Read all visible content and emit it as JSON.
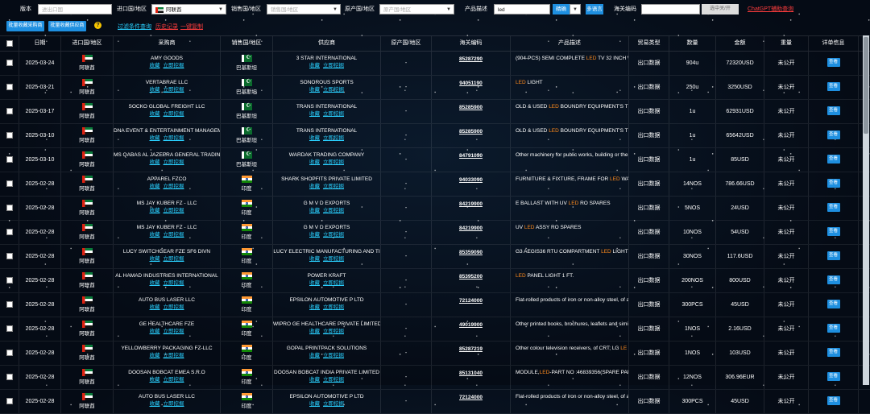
{
  "filters": {
    "version_label": "版本",
    "import_country_label": "进口国/地区",
    "import_country_value": "阿联酋",
    "import_country_box_placeholder": "进出口国",
    "sales_label": "销售国/地区",
    "sales_placeholder": "销售国/地区",
    "origin_label": "原产国/地区",
    "origin_placeholder": "原产国/地区",
    "desc_label": "产品描述",
    "desc_value": "led",
    "mode_value": "精确",
    "multi_btn": "多语言",
    "hs_label": "海关编码",
    "hs_value": "",
    "toggle_label": "选中关/开",
    "chatgpt_link": "ChatGPT辅助查询"
  },
  "actions": {
    "fav_buyer": "批量收藏采购商",
    "fav_supplier": "批量收藏供应商",
    "help_icon": "?",
    "filter_query": "过滤条件查询",
    "history": "历史记录",
    "copy": "一键复制"
  },
  "table": {
    "headers": [
      "日期",
      "进口国/地区",
      "采购商",
      "销售国/地区",
      "供应商",
      "原产国/地区",
      "海关编码",
      "产品描述",
      "贸易类型",
      "数量",
      "金额",
      "重量",
      "详单信息"
    ],
    "fav_label": "收藏",
    "mine_label": "立即挖掘",
    "view_label": "查看",
    "rows": [
      {
        "date": "2025-03-24",
        "imp_flag": "ae",
        "imp": "阿联酋",
        "buyer": "AMY GOODS",
        "sales_flag": "pk",
        "sales": "巴基斯坦",
        "supplier": "3 STAR INTERNATIONAL",
        "origin": "-",
        "hs": "85287290",
        "desc_pre": "(904-PCS) SEMI COMPLETE ",
        "desc_led": "LED",
        "desc_post": " TV 32 INCH WI",
        "trade": "出口数据",
        "qty": "904u",
        "amount": "72320USD",
        "weight": "未公开"
      },
      {
        "date": "2025-03-21",
        "imp_flag": "ae",
        "imp": "阿联酋",
        "buyer": "VERTABRAE LLC",
        "sales_flag": "pk",
        "sales": "巴基斯坦",
        "supplier": "SONOROUS SPORTS",
        "origin": "-",
        "hs": "94051190",
        "desc_pre": "",
        "desc_led": "LED",
        "desc_post": " LIGHT",
        "trade": "出口数据",
        "qty": "250u",
        "amount": "3250USD",
        "weight": "未公开"
      },
      {
        "date": "2025-03-17",
        "imp_flag": "ae",
        "imp": "阿联酋",
        "buyer": "SOCKO GLOBAL FREIGHT LLC",
        "sales_flag": "pk",
        "sales": "巴基斯坦",
        "supplier": "TRANS INTERNATIONAL",
        "origin": "-",
        "hs": "85285900",
        "desc_pre": "OLD & USED ",
        "desc_led": "LED",
        "desc_post": " BOUNDRY EQUIPMENT'S TH",
        "trade": "出口数据",
        "qty": "1u",
        "amount": "62931USD",
        "weight": "未公开"
      },
      {
        "date": "2025-03-10",
        "imp_flag": "ae",
        "imp": "阿联酋",
        "buyer": "DNA EVENT & ENTERTAINMENT MANAGEM",
        "sales_flag": "pk",
        "sales": "巴基斯坦",
        "supplier": "TRANS INTERNATIONAL",
        "origin": "-",
        "hs": "85285900",
        "desc_pre": "OLD & USED ",
        "desc_led": "LED",
        "desc_post": " BOUNDRY EQUIPMENT'S TH",
        "trade": "出口数据",
        "qty": "1u",
        "amount": "65642USD",
        "weight": "未公开"
      },
      {
        "date": "2025-03-10",
        "imp_flag": "ae",
        "imp": "阿联酋",
        "buyer": "MS QABAS AL JAZEERA GENERAL TRADIN",
        "sales_flag": "pk",
        "sales": "巴基斯坦",
        "supplier": "WARDAK TRADING COMPANY",
        "origin": "-",
        "hs": "84791090",
        "desc_pre": "Other machinery for public works, building or the",
        "desc_led": "",
        "desc_post": "",
        "trade": "出口数据",
        "qty": "1u",
        "amount": "85USD",
        "weight": "未公开"
      },
      {
        "date": "2025-02-28",
        "imp_flag": "ae",
        "imp": "阿联酋",
        "buyer": "APPAREL FZCO",
        "sales_flag": "in",
        "sales": "印度",
        "supplier": "SHARK SHOPFITS PRIVATE LIMITED",
        "origin": "-",
        "hs": "94033090",
        "desc_pre": "FURNITURE & FIXTURE, FRAME FOR ",
        "desc_led": "LED",
        "desc_post": " WA",
        "trade": "出口数据",
        "qty": "14NOS",
        "amount": "786.66USD",
        "weight": "未公开"
      },
      {
        "date": "2025-02-28",
        "imp_flag": "ae",
        "imp": "阿联酋",
        "buyer": "MS JAY KUBER FZ - LLC",
        "sales_flag": "in",
        "sales": "印度",
        "supplier": "G M V D EXPORTS",
        "origin": "-",
        "hs": "84219900",
        "desc_pre": "E BALLAST WITH UV ",
        "desc_led": "LED",
        "desc_post": " RO SPARES",
        "trade": "出口数据",
        "qty": "5NOS",
        "amount": "24USD",
        "weight": "未公开"
      },
      {
        "date": "2025-02-28",
        "imp_flag": "ae",
        "imp": "阿联酋",
        "buyer": "MS JAY KUBER FZ - LLC",
        "sales_flag": "in",
        "sales": "印度",
        "supplier": "G M V D EXPORTS",
        "origin": "-",
        "hs": "84219900",
        "desc_pre": "UV ",
        "desc_led": "LED",
        "desc_post": " ASSY RO SPARES",
        "trade": "出口数据",
        "qty": "10NOS",
        "amount": "54USD",
        "weight": "未公开"
      },
      {
        "date": "2025-02-28",
        "imp_flag": "ae",
        "imp": "阿联酋",
        "buyer": "LUCY SWITCHGEAR FZE SF6 DIVN",
        "sales_flag": "in",
        "sales": "印度",
        "supplier": "LUCY ELECTRIC MANUFACTURING AND TI",
        "origin": "-",
        "hs": "85359090",
        "desc_pre": "G3 AEGIS36 RTU COMPARTMENT ",
        "desc_led": "LED",
        "desc_post": " LIGHT",
        "trade": "出口数据",
        "qty": "30NOS",
        "amount": "117.6USD",
        "weight": "未公开"
      },
      {
        "date": "2025-02-28",
        "imp_flag": "ae",
        "imp": "阿联酋",
        "buyer": "AL HAMAD INDUSTRIES INTERNATIONAL",
        "sales_flag": "in",
        "sales": "印度",
        "supplier": "POWER KRAFT",
        "origin": "-",
        "hs": "85395200",
        "desc_pre": "",
        "desc_led": "LED",
        "desc_post": " PANEL LIGHT 1 FT.",
        "trade": "出口数据",
        "qty": "200NOS",
        "amount": "800USD",
        "weight": "未公开"
      },
      {
        "date": "2025-02-28",
        "imp_flag": "ae",
        "imp": "阿联酋",
        "buyer": "AUTO BUS LASER LLC",
        "sales_flag": "in",
        "sales": "印度",
        "supplier": "EPSILON AUTOMOTIVE P LTD",
        "origin": "-",
        "hs": "72124000",
        "desc_pre": "Flat-rolled products of iron or non-alloy steel, of a",
        "desc_led": "",
        "desc_post": "",
        "trade": "出口数据",
        "qty": "300PCS",
        "amount": "45USD",
        "weight": "未公开"
      },
      {
        "date": "2025-02-28",
        "imp_flag": "ae",
        "imp": "阿联酋",
        "buyer": "GE HEALTHCARE FZE",
        "sales_flag": "in",
        "sales": "印度",
        "supplier": "WIPRO GE HEALTHCARE PRIVATE LIMITED",
        "origin": "-",
        "hs": "49019900",
        "desc_pre": "Other printed books, brochures, leaflets and simil",
        "desc_led": "",
        "desc_post": "",
        "trade": "出口数据",
        "qty": "1NOS",
        "amount": "2.16USD",
        "weight": "未公开"
      },
      {
        "date": "2025-02-28",
        "imp_flag": "ae",
        "imp": "阿联酋",
        "buyer": "YELLOWBERRY PACKAGING FZ-LLC",
        "sales_flag": "in",
        "sales": "印度",
        "supplier": "GOPAL PRINTPACK SOLUTIONS",
        "origin": "-",
        "hs": "85287219",
        "desc_pre": "Other colour television receivers, of CRT; LG ",
        "desc_led": "LE",
        "desc_post": "",
        "trade": "出口数据",
        "qty": "1NOS",
        "amount": "103USD",
        "weight": "未公开"
      },
      {
        "date": "2025-02-28",
        "imp_flag": "ae",
        "imp": "阿联酋",
        "buyer": "DOOSAN BOBCAT EMEA S.R.O",
        "sales_flag": "in",
        "sales": "印度",
        "supplier": "DOOSAN BOBCAT INDIA PRIVATE LIMITED",
        "origin": "-",
        "hs": "85131040",
        "desc_pre": "MODULE,",
        "desc_led": "LED",
        "desc_post": "-PART NO :46839356(SPARE PAR",
        "trade": "出口数据",
        "qty": "12NOS",
        "amount": "306.96EUR",
        "weight": "未公开"
      },
      {
        "date": "2025-02-28",
        "imp_flag": "ae",
        "imp": "阿联酋",
        "buyer": "AUTO BUS LASER LLC",
        "sales_flag": "in",
        "sales": "印度",
        "supplier": "EPSILON AUTOMOTIVE P LTD",
        "origin": "-",
        "hs": "72124000",
        "desc_pre": "Flat-rolled products of iron or non-alloy steel, of a",
        "desc_led": "",
        "desc_post": "",
        "trade": "出口数据",
        "qty": "300PCS",
        "amount": "45USD",
        "weight": "未公开"
      }
    ]
  }
}
